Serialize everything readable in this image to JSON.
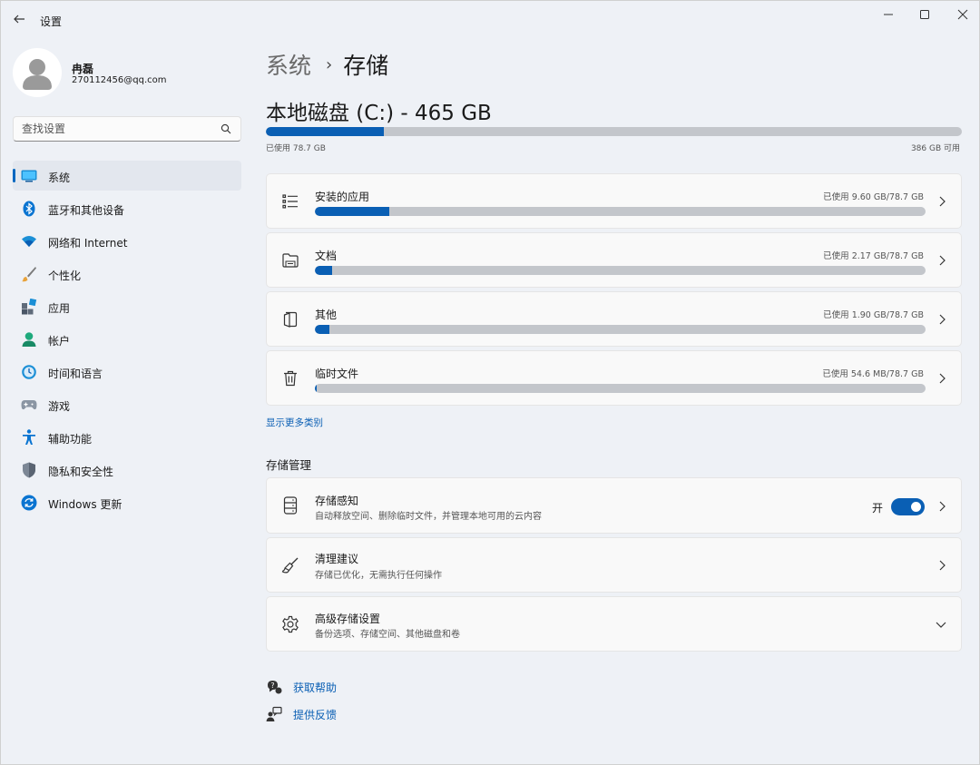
{
  "window": {
    "app_title": "设置",
    "back_icon": "back-arrow-icon",
    "controls": [
      "minimize-icon",
      "maximize-icon",
      "close-icon"
    ]
  },
  "profile": {
    "name": "冉磊",
    "email": "270112456@qq.com"
  },
  "search": {
    "placeholder": "查找设置"
  },
  "sidebar": {
    "items": [
      {
        "label": "系统",
        "icon": "system-icon",
        "active": true
      },
      {
        "label": "蓝牙和其他设备",
        "icon": "bluetooth-icon"
      },
      {
        "label": "网络和 Internet",
        "icon": "wifi-icon"
      },
      {
        "label": "个性化",
        "icon": "brush-icon"
      },
      {
        "label": "应用",
        "icon": "apps-icon"
      },
      {
        "label": "帐户",
        "icon": "account-icon"
      },
      {
        "label": "时间和语言",
        "icon": "time-language-icon"
      },
      {
        "label": "游戏",
        "icon": "gamepad-icon"
      },
      {
        "label": "辅助功能",
        "icon": "accessibility-icon"
      },
      {
        "label": "隐私和安全性",
        "icon": "shield-icon"
      },
      {
        "label": "Windows 更新",
        "icon": "windows-update-icon"
      }
    ]
  },
  "breadcrumb": {
    "parent": "系统",
    "separator": "›",
    "current": "存储"
  },
  "disk": {
    "title": "本地磁盘 (C:) - 465 GB",
    "used_label": "已使用 78.7 GB",
    "free_label": "386 GB 可用",
    "used_fraction": 0.169
  },
  "categories": [
    {
      "title": "安装的应用",
      "usage": "已使用 9.60 GB/78.7 GB",
      "fraction": 0.122,
      "icon": "list-icon"
    },
    {
      "title": "文档",
      "usage": "已使用 2.17 GB/78.7 GB",
      "fraction": 0.028,
      "icon": "folder-icon"
    },
    {
      "title": "其他",
      "usage": "已使用 1.90 GB/78.7 GB",
      "fraction": 0.024,
      "icon": "other-files-icon"
    },
    {
      "title": "临时文件",
      "usage": "已使用 54.6 MB/78.7 GB",
      "fraction": 0.001,
      "icon": "trash-icon"
    }
  ],
  "show_more": "显示更多类别",
  "management": {
    "title": "存储管理",
    "items": [
      {
        "title": "存储感知",
        "subtitle": "自动释放空间、删除临时文件，并管理本地可用的云内容",
        "toggle_label": "开",
        "toggle_on": true,
        "icon": "storage-sense-icon"
      },
      {
        "title": "清理建议",
        "subtitle": "存储已优化，无需执行任何操作",
        "icon": "broom-icon"
      },
      {
        "title": "高级存储设置",
        "subtitle": "备份选项、存储空间、其他磁盘和卷",
        "icon": "gear-icon"
      }
    ]
  },
  "footer": {
    "help": "获取帮助",
    "feedback": "提供反馈"
  },
  "colors": {
    "accent": "#0a5fb4",
    "bar_track": "#c3c6cb",
    "background": "#eef1f6"
  }
}
